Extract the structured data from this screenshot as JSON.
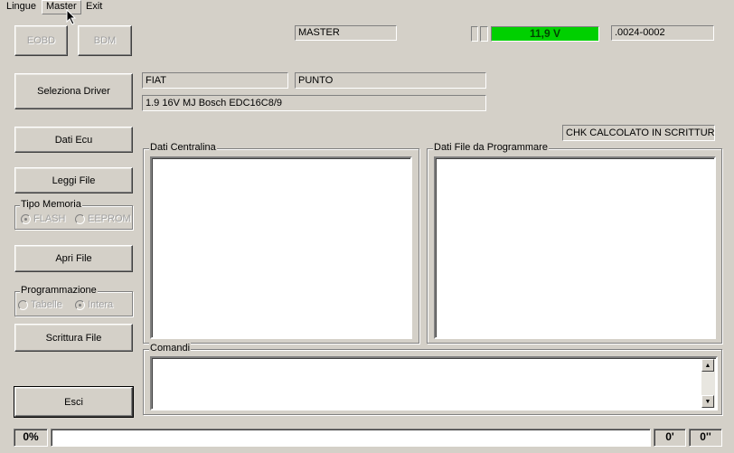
{
  "menu": {
    "items": [
      {
        "label": "Lingue"
      },
      {
        "label": "Master"
      },
      {
        "label": "Exit"
      }
    ]
  },
  "toolbar": {
    "eobd_label": "EOBD",
    "bdm_label": "BDM"
  },
  "header": {
    "mode_display": "MASTER",
    "voltage_display": "11,9 V",
    "serial_display": ".0024-0002"
  },
  "driver": {
    "select_label": "Seleziona Driver",
    "brand": "FIAT",
    "model": "PUNTO",
    "engine": "1.9  16V  MJ Bosch EDC16C8/9"
  },
  "checksum": {
    "status_text": "CHK CALCOLATO IN SCRITTURA"
  },
  "actions": {
    "dati_ecu_label": "Dati Ecu",
    "leggi_file_label": "Leggi File",
    "apri_file_label": "Apri File",
    "scrittura_file_label": "Scrittura File",
    "esci_label": "Esci"
  },
  "memory_type": {
    "title": "Tipo Memoria",
    "options": [
      {
        "label": "FLASH",
        "checked": true
      },
      {
        "label": "EEPROM",
        "checked": false
      }
    ]
  },
  "programming": {
    "title": "Programmazione",
    "options": [
      {
        "label": "Tabelle",
        "checked": false
      },
      {
        "label": "Intera",
        "checked": true
      }
    ]
  },
  "panels": {
    "dati_centralina": "Dati Centralina",
    "dati_file": "Dati File da Programmare",
    "comandi": "Comandi"
  },
  "statusbar": {
    "percent": "0%",
    "minutes": "0'",
    "seconds": "0''",
    "progress": 0
  }
}
